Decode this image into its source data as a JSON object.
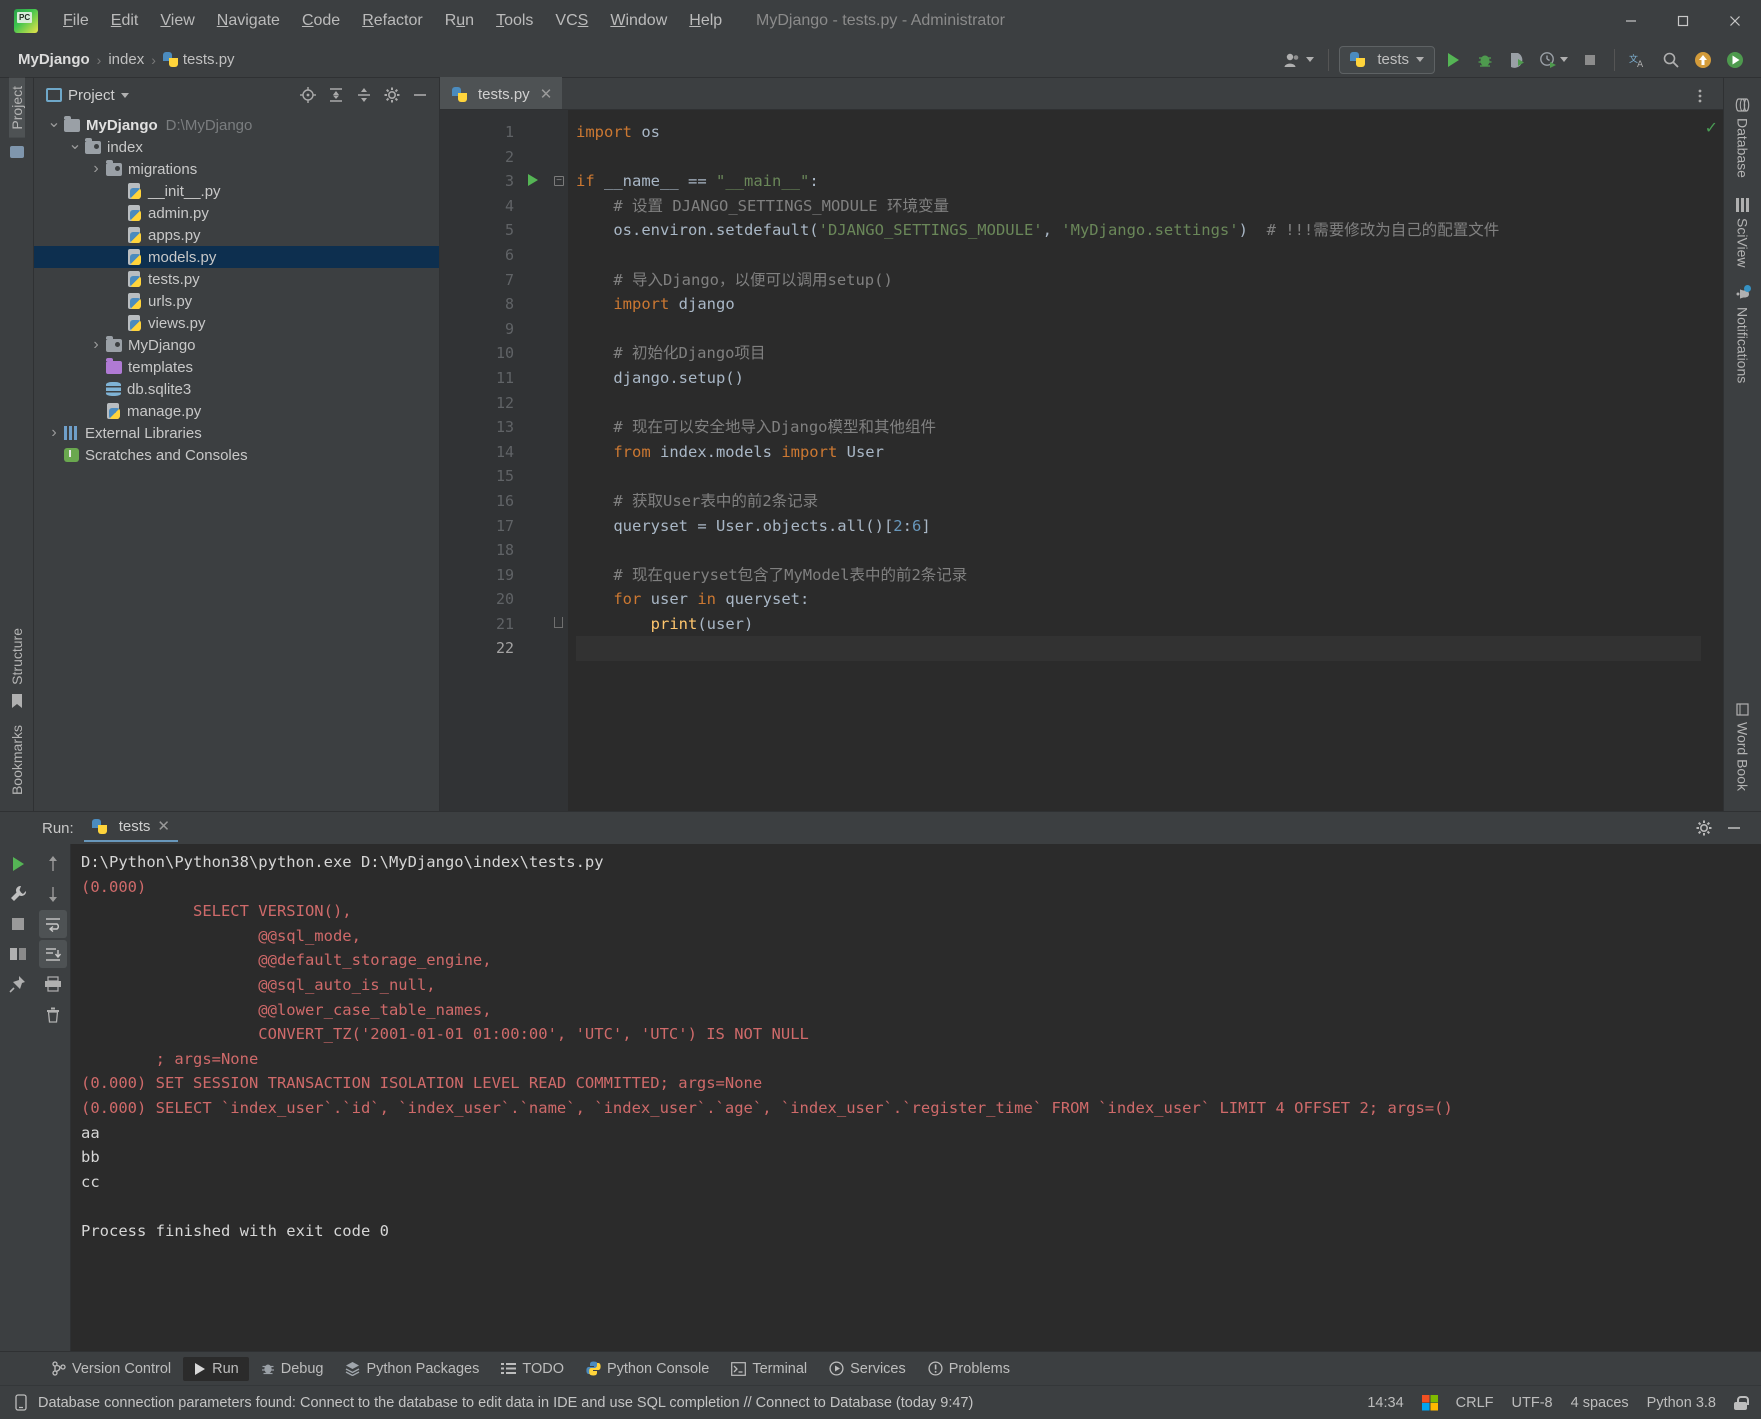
{
  "window": {
    "title": "MyDjango - tests.py - Administrator",
    "minimize_label": "—",
    "maximize_label": "☐",
    "close_label": "✕"
  },
  "menu": [
    "File",
    "Edit",
    "View",
    "Navigate",
    "Code",
    "Refactor",
    "Run",
    "Tools",
    "VCS",
    "Window",
    "Help"
  ],
  "breadcrumb": {
    "project": "MyDjango",
    "folder": "index",
    "file": "tests.py",
    "sep": "›"
  },
  "toolbar": {
    "run_config": "tests",
    "run_tooltip": "Run",
    "debug_tooltip": "Debug",
    "coverage_tooltip": "Run with Coverage",
    "profile_tooltip": "Profile",
    "stop_tooltip": "Stop",
    "translate_tooltip": "Translate",
    "search_tooltip": "Search Everywhere",
    "update_tooltip": "Update Project",
    "settings_tooltip": "Settings"
  },
  "left_stripe": {
    "project_label": "Project",
    "bookmarks_label": "Bookmarks",
    "structure_label": "Structure"
  },
  "project_panel": {
    "title": "Project",
    "icons": [
      "locate-icon",
      "expand-all-icon",
      "collapse-all-icon",
      "gear-icon",
      "hide-icon"
    ],
    "tree": [
      {
        "label": "MyDjango",
        "path": "D:\\MyDjango",
        "icon": "folder-icon",
        "indent": 0,
        "arrow": "down",
        "bold": true,
        "selected": false
      },
      {
        "label": "index",
        "path": "",
        "icon": "module-folder-icon",
        "indent": 1,
        "arrow": "down",
        "bold": false,
        "selected": false
      },
      {
        "label": "migrations",
        "path": "",
        "icon": "module-folder-icon",
        "indent": 2,
        "arrow": "right",
        "bold": false,
        "selected": false
      },
      {
        "label": "__init__.py",
        "path": "",
        "icon": "python-file-icon",
        "indent": 3,
        "arrow": "",
        "bold": false,
        "selected": false
      },
      {
        "label": "admin.py",
        "path": "",
        "icon": "python-file-icon",
        "indent": 3,
        "arrow": "",
        "bold": false,
        "selected": false
      },
      {
        "label": "apps.py",
        "path": "",
        "icon": "python-file-icon",
        "indent": 3,
        "arrow": "",
        "bold": false,
        "selected": false
      },
      {
        "label": "models.py",
        "path": "",
        "icon": "python-file-icon",
        "indent": 3,
        "arrow": "",
        "bold": false,
        "selected": true
      },
      {
        "label": "tests.py",
        "path": "",
        "icon": "python-file-icon",
        "indent": 3,
        "arrow": "",
        "bold": false,
        "selected": false
      },
      {
        "label": "urls.py",
        "path": "",
        "icon": "python-file-icon",
        "indent": 3,
        "arrow": "",
        "bold": false,
        "selected": false
      },
      {
        "label": "views.py",
        "path": "",
        "icon": "python-file-icon",
        "indent": 3,
        "arrow": "",
        "bold": false,
        "selected": false
      },
      {
        "label": "MyDjango",
        "path": "",
        "icon": "module-folder-icon",
        "indent": 2,
        "arrow": "right",
        "bold": false,
        "selected": false
      },
      {
        "label": "templates",
        "path": "",
        "icon": "template-folder-icon",
        "indent": 2,
        "arrow": "",
        "bold": false,
        "selected": false
      },
      {
        "label": "db.sqlite3",
        "path": "",
        "icon": "database-file-icon",
        "indent": 2,
        "arrow": "",
        "bold": false,
        "selected": false
      },
      {
        "label": "manage.py",
        "path": "",
        "icon": "python-file-icon",
        "indent": 2,
        "arrow": "",
        "bold": false,
        "selected": false
      },
      {
        "label": "External Libraries",
        "path": "",
        "icon": "library-icon",
        "indent": 0,
        "arrow": "right",
        "bold": false,
        "selected": false
      },
      {
        "label": "Scratches and Consoles",
        "path": "",
        "icon": "scratch-icon",
        "indent": 0,
        "arrow": "",
        "bold": false,
        "selected": false
      }
    ]
  },
  "editor": {
    "tab": {
      "label": "tests.py",
      "close": "✕"
    },
    "inspection_ok": "✓",
    "lines": [
      {
        "n": 1,
        "tokens": [
          {
            "t": "import",
            "c": "kw"
          },
          {
            "t": " os",
            "c": ""
          }
        ]
      },
      {
        "n": 2,
        "tokens": []
      },
      {
        "n": 3,
        "tokens": [
          {
            "t": "if",
            "c": "kw"
          },
          {
            "t": " __name__ ",
            "c": ""
          },
          {
            "t": "==",
            "c": ""
          },
          {
            "t": " ",
            "c": ""
          },
          {
            "t": "\"__main__\"",
            "c": "str"
          },
          {
            "t": ":",
            "c": ""
          }
        ],
        "runmark": true,
        "fold": true
      },
      {
        "n": 4,
        "tokens": [
          {
            "t": "    # 设置 DJANGO_SETTINGS_MODULE 环境变量",
            "c": "com"
          }
        ]
      },
      {
        "n": 5,
        "tokens": [
          {
            "t": "    os.environ.setdefault(",
            "c": ""
          },
          {
            "t": "'DJANGO_SETTINGS_MODULE'",
            "c": "str"
          },
          {
            "t": ", ",
            "c": ""
          },
          {
            "t": "'MyDjango.settings'",
            "c": "str"
          },
          {
            "t": ")  ",
            "c": ""
          },
          {
            "t": "# !!!需要修改为自己的配置文件",
            "c": "com"
          }
        ]
      },
      {
        "n": 6,
        "tokens": []
      },
      {
        "n": 7,
        "tokens": [
          {
            "t": "    # 导入Django，以便可以调用setup()",
            "c": "com"
          }
        ]
      },
      {
        "n": 8,
        "tokens": [
          {
            "t": "    ",
            "c": ""
          },
          {
            "t": "import",
            "c": "kw"
          },
          {
            "t": " django",
            "c": ""
          }
        ]
      },
      {
        "n": 9,
        "tokens": []
      },
      {
        "n": 10,
        "tokens": [
          {
            "t": "    # 初始化Django项目",
            "c": "com"
          }
        ]
      },
      {
        "n": 11,
        "tokens": [
          {
            "t": "    django.setup()",
            "c": ""
          }
        ]
      },
      {
        "n": 12,
        "tokens": []
      },
      {
        "n": 13,
        "tokens": [
          {
            "t": "    # 现在可以安全地导入Django模型和其他组件",
            "c": "com"
          }
        ]
      },
      {
        "n": 14,
        "tokens": [
          {
            "t": "    ",
            "c": ""
          },
          {
            "t": "from",
            "c": "kw"
          },
          {
            "t": " index.models ",
            "c": ""
          },
          {
            "t": "import",
            "c": "kw"
          },
          {
            "t": " User",
            "c": ""
          }
        ]
      },
      {
        "n": 15,
        "tokens": []
      },
      {
        "n": 16,
        "tokens": [
          {
            "t": "    # 获取User表中的前2条记录",
            "c": "com"
          }
        ]
      },
      {
        "n": 17,
        "tokens": [
          {
            "t": "    queryset = User.objects.all()[",
            "c": ""
          },
          {
            "t": "2",
            "c": "num"
          },
          {
            "t": ":",
            "c": ""
          },
          {
            "t": "6",
            "c": "num"
          },
          {
            "t": "]",
            "c": ""
          }
        ]
      },
      {
        "n": 18,
        "tokens": []
      },
      {
        "n": 19,
        "tokens": [
          {
            "t": "    # 现在queryset包含了MyModel表中的前2条记录",
            "c": "com"
          }
        ]
      },
      {
        "n": 20,
        "tokens": [
          {
            "t": "    ",
            "c": ""
          },
          {
            "t": "for",
            "c": "kw"
          },
          {
            "t": " user ",
            "c": ""
          },
          {
            "t": "in",
            "c": "kw"
          },
          {
            "t": " queryset:",
            "c": ""
          }
        ]
      },
      {
        "n": 21,
        "tokens": [
          {
            "t": "        ",
            "c": ""
          },
          {
            "t": "print",
            "c": "fn"
          },
          {
            "t": "(user)",
            "c": ""
          }
        ],
        "gutterhint": true
      },
      {
        "n": 22,
        "tokens": [],
        "current": true
      }
    ]
  },
  "run_panel": {
    "label": "Run:",
    "tab": "tests",
    "tab_close": "✕",
    "toolbar_left": [
      "rerun-icon",
      "wrench-icon",
      "stop-icon",
      "layout-icon",
      "pin-icon"
    ],
    "toolbar_right": [
      "up-icon",
      "down-icon",
      "soft-wrap-icon",
      "scroll-end-icon",
      "print-icon",
      "trash-icon"
    ],
    "header_right": [
      "gear-icon",
      "hide-icon"
    ],
    "console": [
      {
        "text": "D:\\Python\\Python38\\python.exe D:\\MyDjango\\index\\tests.py",
        "color": "white"
      },
      {
        "text": "(0.000)",
        "color": "red"
      },
      {
        "text": "            SELECT VERSION(),",
        "color": "red"
      },
      {
        "text": "                   @@sql_mode,",
        "color": "red"
      },
      {
        "text": "                   @@default_storage_engine,",
        "color": "red"
      },
      {
        "text": "                   @@sql_auto_is_null,",
        "color": "red"
      },
      {
        "text": "                   @@lower_case_table_names,",
        "color": "red"
      },
      {
        "text": "                   CONVERT_TZ('2001-01-01 01:00:00', 'UTC', 'UTC') IS NOT NULL",
        "color": "red"
      },
      {
        "text": "        ; args=None",
        "color": "red"
      },
      {
        "text": "(0.000) SET SESSION TRANSACTION ISOLATION LEVEL READ COMMITTED; args=None",
        "color": "red"
      },
      {
        "text": "(0.000) SELECT `index_user`.`id`, `index_user`.`name`, `index_user`.`age`, `index_user`.`register_time` FROM `index_user` LIMIT 4 OFFSET 2; args=()",
        "color": "red"
      },
      {
        "text": "aa",
        "color": "white"
      },
      {
        "text": "bb",
        "color": "white"
      },
      {
        "text": "cc",
        "color": "white"
      },
      {
        "text": "",
        "color": "white"
      },
      {
        "text": "Process finished with exit code 0",
        "color": "white"
      }
    ]
  },
  "bottom_tools": [
    {
      "label": "Version Control",
      "icon": "branch-icon",
      "active": false
    },
    {
      "label": "Run",
      "icon": "play-icon",
      "active": true
    },
    {
      "label": "Debug",
      "icon": "bug-icon",
      "active": false
    },
    {
      "label": "Python Packages",
      "icon": "packages-icon",
      "active": false
    },
    {
      "label": "TODO",
      "icon": "todo-icon",
      "active": false
    },
    {
      "label": "Python Console",
      "icon": "python-icon",
      "active": false
    },
    {
      "label": "Terminal",
      "icon": "terminal-icon",
      "active": false
    },
    {
      "label": "Services",
      "icon": "services-icon",
      "active": false
    },
    {
      "label": "Problems",
      "icon": "problems-icon",
      "active": false
    }
  ],
  "right_stripe": [
    {
      "label": "Database",
      "icon": "database-icon"
    },
    {
      "label": "SciView",
      "icon": "grid-icon"
    },
    {
      "label": "Notifications",
      "icon": "bell-icon"
    }
  ],
  "right_stripe_bottom": {
    "label": "Word Book",
    "icon": "book-icon"
  },
  "status": {
    "message": "Database connection parameters found: Connect to the database to edit data in IDE and use SQL completion // Connect to Database (today 9:47)",
    "time": "14:34",
    "line_sep": "CRLF",
    "encoding": "UTF-8",
    "indent": "4 spaces",
    "interpreter": "Python 3.8"
  }
}
